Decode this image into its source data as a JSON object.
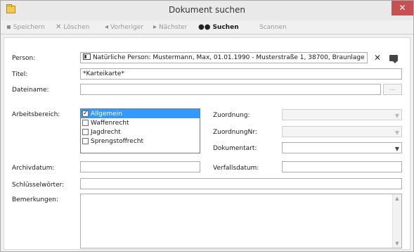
{
  "window": {
    "title": "Dokument suchen",
    "close_symbol": "✕",
    "app_icon": "folder-icon"
  },
  "toolbar": {
    "save_label": "Speichern",
    "delete_label": "Löschen",
    "previous_label": "Vorheriger",
    "next_label": "Nächster",
    "search_label": "Suchen",
    "scan_label": "Scannen"
  },
  "form": {
    "person": {
      "label": "Person:",
      "value": "Natürliche Person: Mustermann, Max, 01.01.1990 - Musterstraße 1, 38700, Braunlage"
    },
    "titel": {
      "label": "Titel:",
      "value": "*Karteikarte*"
    },
    "dateiname": {
      "label": "Dateiname:",
      "value": "",
      "browse_label": "..."
    },
    "arbeitsbereich": {
      "label": "Arbeitsbereich:",
      "items": [
        {
          "label": "Allgemein",
          "checked": true,
          "selected": true
        },
        {
          "label": "Waffenrecht",
          "checked": false,
          "selected": false
        },
        {
          "label": "Jagdrecht",
          "checked": false,
          "selected": false
        },
        {
          "label": "Sprengstoffrecht",
          "checked": false,
          "selected": false
        }
      ]
    },
    "zuordnung": {
      "label": "Zuordnung:",
      "value": ""
    },
    "zuordnung_nr": {
      "label": "ZuordnungNr:",
      "value": ""
    },
    "dokumentart": {
      "label": "Dokumentart:",
      "value": ""
    },
    "archivdatum": {
      "label": "Archivdatum:",
      "value": ""
    },
    "verfallsdatum": {
      "label": "Verfallsdatum:",
      "value": ""
    },
    "schluesselwoerter": {
      "label": "Schlüsselwörter:",
      "value": ""
    },
    "bemerkungen": {
      "label": "Bemerkungen:",
      "value": ""
    }
  },
  "colors": {
    "selection": "#3399ff",
    "close_button": "#c75050"
  }
}
